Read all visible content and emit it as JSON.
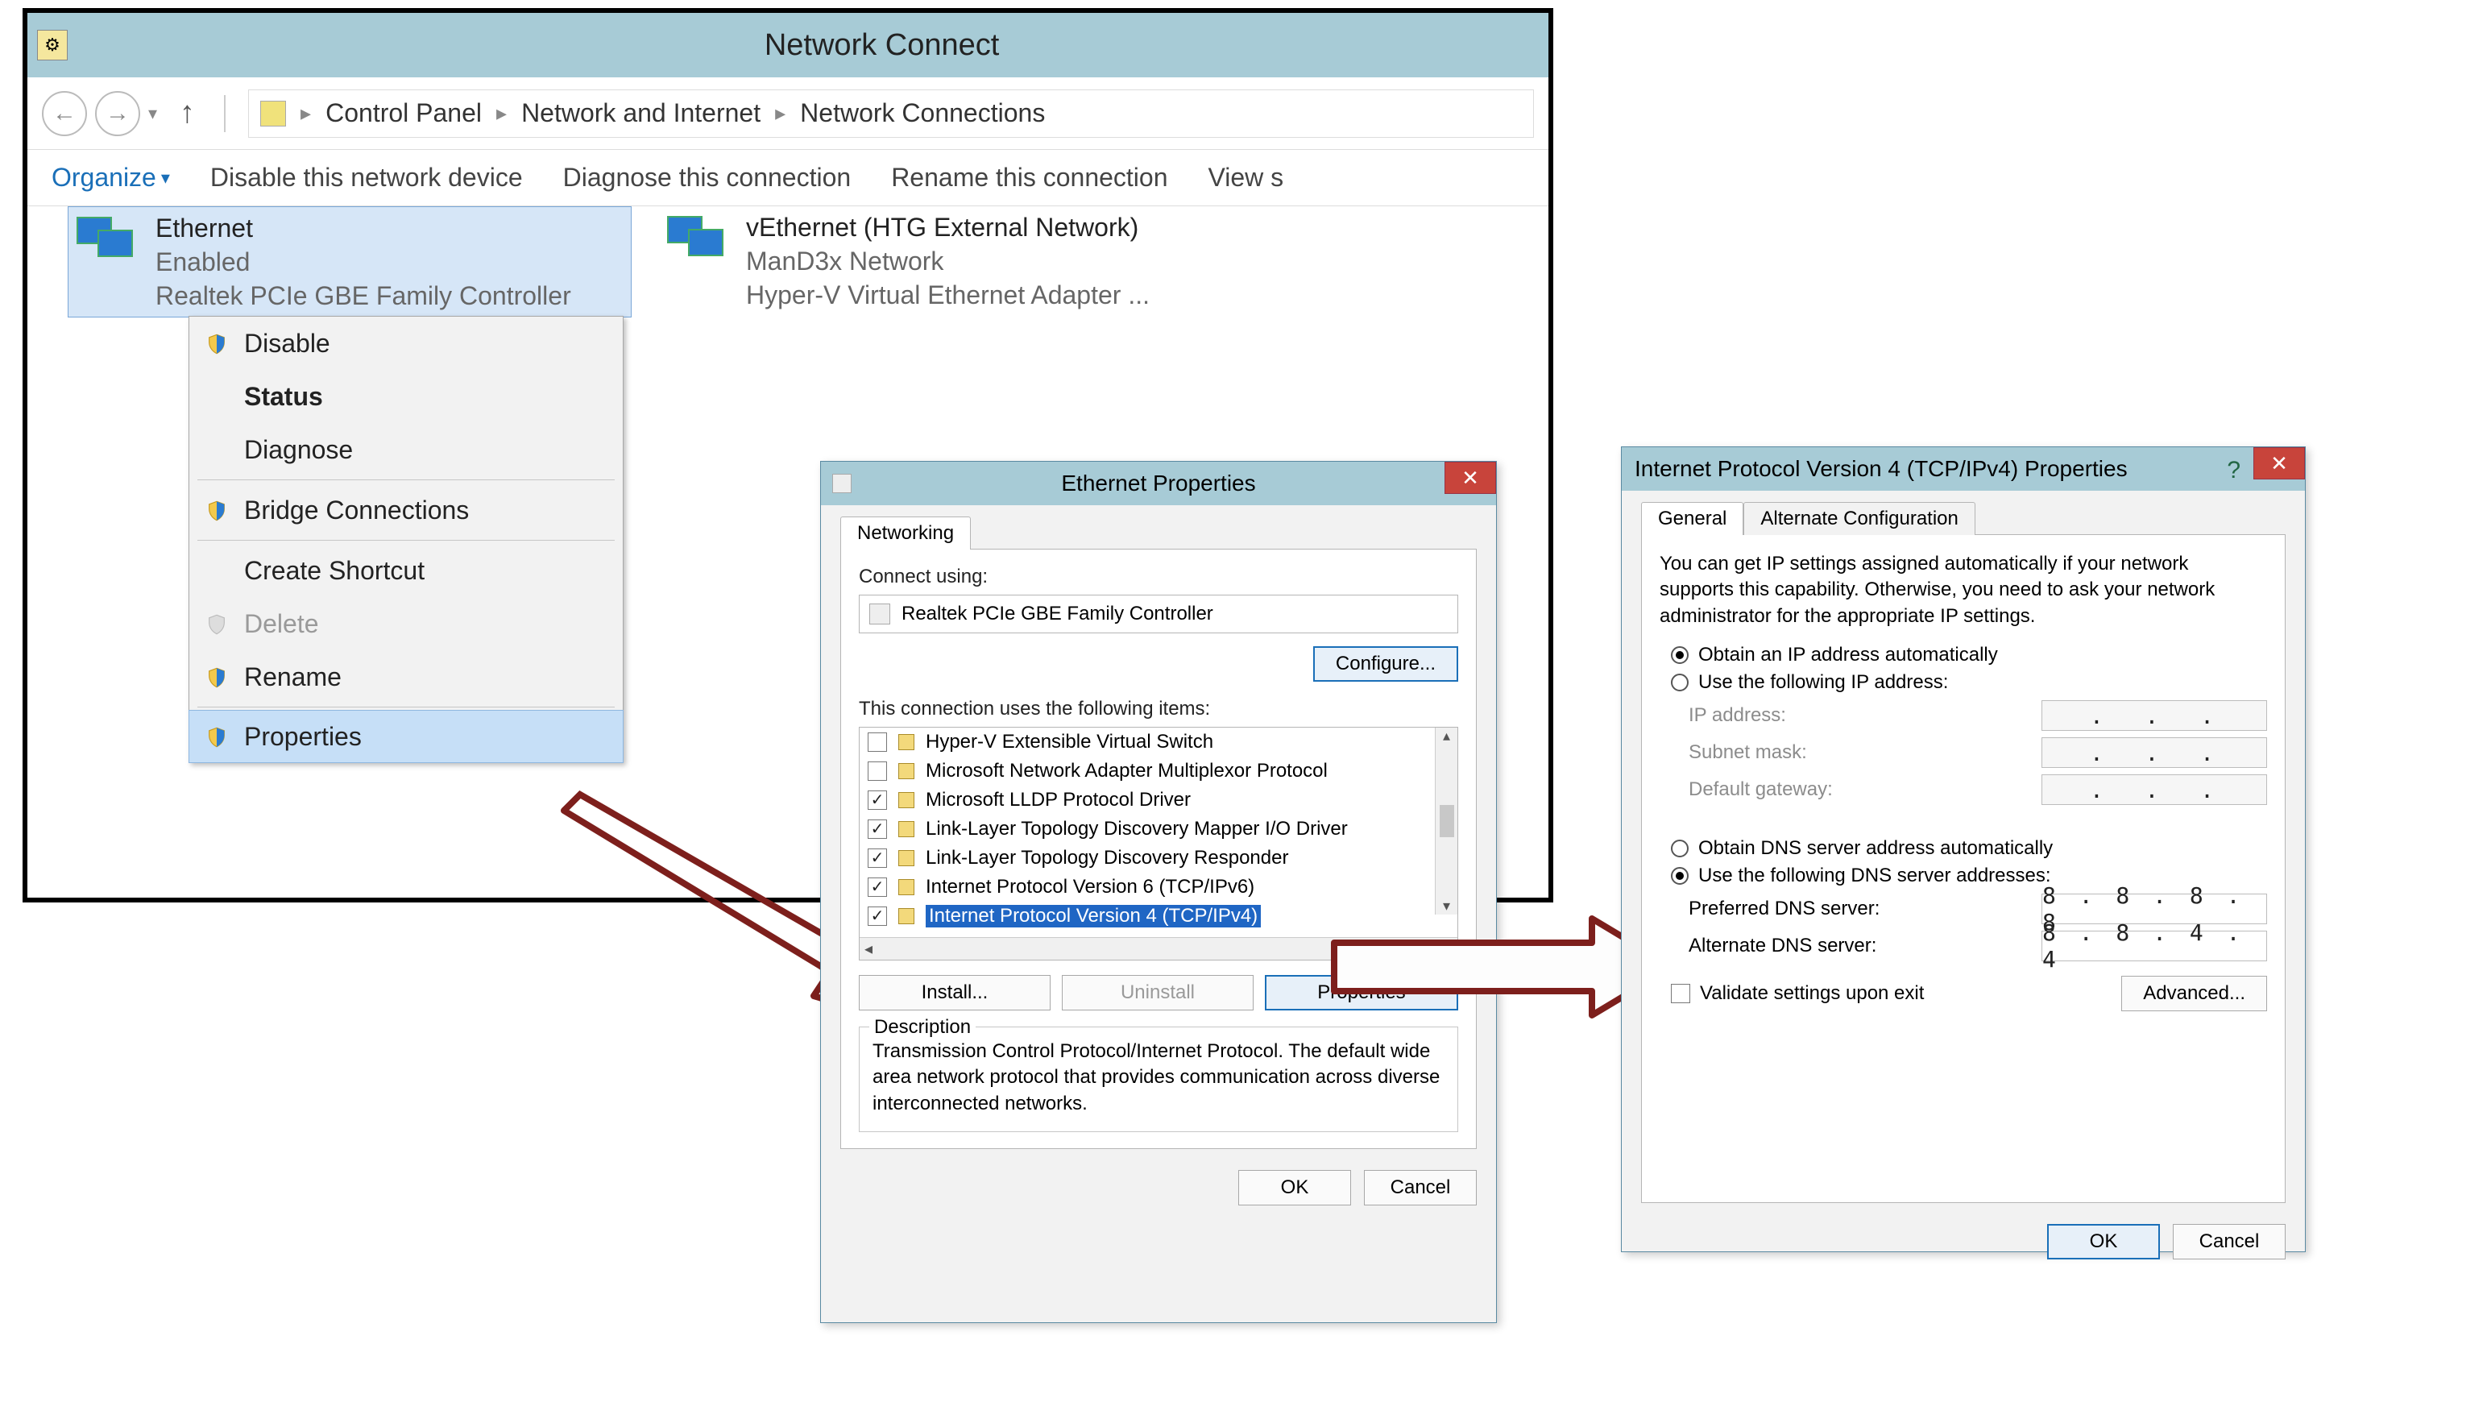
{
  "mainWindow": {
    "title": "Network Connect",
    "breadcrumb": {
      "p1": "Control Panel",
      "p2": "Network and Internet",
      "p3": "Network Connections"
    },
    "toolbar": {
      "organize": "Organize",
      "disable": "Disable this network device",
      "diagnose": "Diagnose this connection",
      "rename": "Rename this connection",
      "view": "View s"
    },
    "conn1": {
      "name": "Ethernet",
      "status": "Enabled",
      "device": "Realtek PCIe GBE Family Controller"
    },
    "conn2": {
      "name": "vEthernet (HTG External Network)",
      "status": "ManD3x Network",
      "device": "Hyper-V Virtual Ethernet Adapter ..."
    },
    "ctx": {
      "disable": "Disable",
      "status": "Status",
      "diagnose": "Diagnose",
      "bridge": "Bridge Connections",
      "shortcut": "Create Shortcut",
      "delete": "Delete",
      "rename": "Rename",
      "properties": "Properties"
    }
  },
  "ethDialog": {
    "title": "Ethernet Properties",
    "tab": "Networking",
    "connectUsingLabel": "Connect using:",
    "adapter": "Realtek PCIe GBE Family Controller",
    "configure": "Configure...",
    "itemsLabel": "This connection uses the following items:",
    "items": [
      {
        "checked": false,
        "label": "Hyper-V Extensible Virtual Switch"
      },
      {
        "checked": false,
        "label": "Microsoft Network Adapter Multiplexor Protocol"
      },
      {
        "checked": true,
        "label": "Microsoft LLDP Protocol Driver"
      },
      {
        "checked": true,
        "label": "Link-Layer Topology Discovery Mapper I/O Driver"
      },
      {
        "checked": true,
        "label": "Link-Layer Topology Discovery Responder"
      },
      {
        "checked": true,
        "label": "Internet Protocol Version 6 (TCP/IPv6)"
      },
      {
        "checked": true,
        "label": "Internet Protocol Version 4 (TCP/IPv4)",
        "selected": true
      }
    ],
    "install": "Install...",
    "uninstall": "Uninstall",
    "properties": "Properties",
    "descTitle": "Description",
    "descText": "Transmission Control Protocol/Internet Protocol. The default wide area network protocol that provides communication across diverse interconnected networks.",
    "ok": "OK",
    "cancel": "Cancel"
  },
  "ipv4Dialog": {
    "title": "Internet Protocol Version 4 (TCP/IPv4) Properties",
    "tabs": {
      "general": "General",
      "alt": "Alternate Configuration"
    },
    "intro": "You can get IP settings assigned automatically if your network supports this capability. Otherwise, you need to ask your network administrator for the appropriate IP settings.",
    "r_auto_ip": "Obtain an IP address automatically",
    "r_use_ip": "Use the following IP address:",
    "ip_label": "IP address:",
    "mask_label": "Subnet mask:",
    "gw_label": "Default gateway:",
    "r_auto_dns": "Obtain DNS server address automatically",
    "r_use_dns": "Use the following DNS server addresses:",
    "pref_dns_label": "Preferred DNS server:",
    "alt_dns_label": "Alternate DNS server:",
    "pref_dns": "8 . 8 . 8 . 8",
    "alt_dns": "8 . 8 . 4 . 4",
    "validate": "Validate settings upon exit",
    "advanced": "Advanced...",
    "ok": "OK",
    "cancel": "Cancel"
  }
}
